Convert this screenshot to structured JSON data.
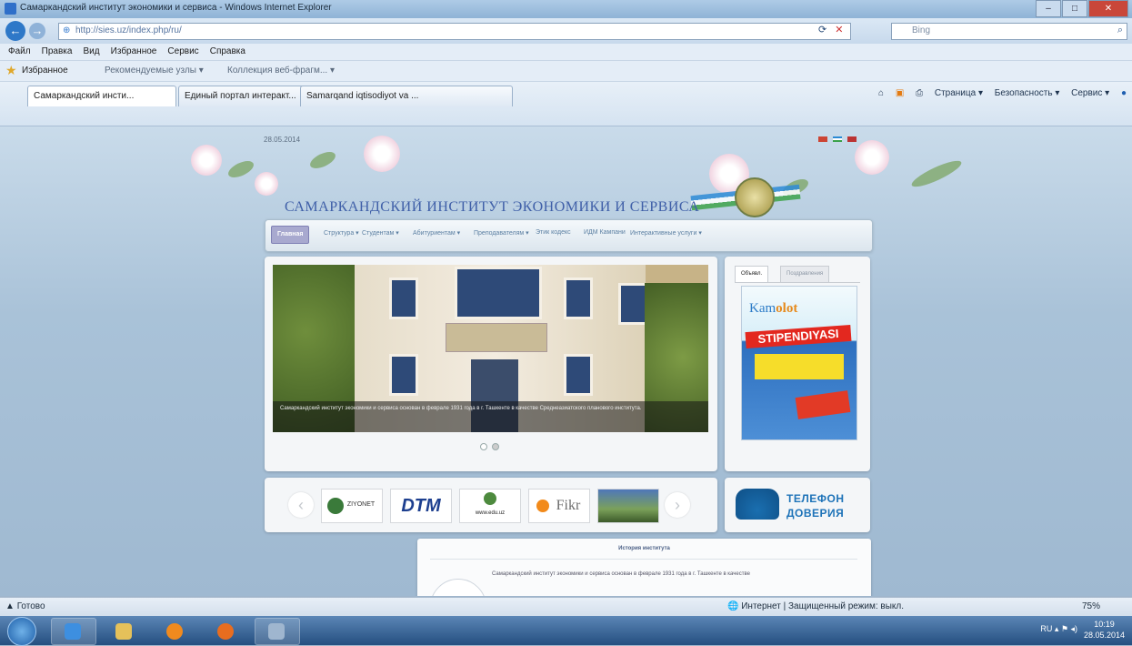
{
  "window": {
    "title": "Самаркандский институт экономики и сервиса - Windows Internet Explorer",
    "buttons": [
      "–",
      "□",
      "✕"
    ]
  },
  "address_bar": {
    "url": "http://sies.uz/index.php/ru/",
    "search_placeholder": "Bing"
  },
  "menu": [
    "Файл",
    "Правка",
    "Вид",
    "Избранное",
    "Сервис",
    "Справка"
  ],
  "favorites_bar": {
    "label": "Избранное",
    "items": [
      "Рекомендуемые узлы ▾",
      "Коллекция веб-фрагм... ▾"
    ]
  },
  "tabs": [
    {
      "label": "Самаркандский инсти...",
      "active": true
    },
    {
      "label": "Единый портал интеракт...",
      "active": false
    },
    {
      "label": "Samarqand iqtisodiyot va ...",
      "active": false
    }
  ],
  "command_bar": [
    "Страница ▾",
    "Безопасность ▾",
    "Сервис ▾"
  ],
  "page": {
    "date": "28.05.2014",
    "site_title": "САМАРКАНДСКИЙ ИНСТИТУТ ЭКОНОМИКИ И СЕРВИСА",
    "nav": [
      {
        "label": "Главная",
        "active": true
      },
      {
        "label": "Структура ▾"
      },
      {
        "label": "Студентам ▾"
      },
      {
        "label": "Абитуриентам ▾"
      },
      {
        "label": "Преподавателям ▾"
      },
      {
        "label": "Этик кодекс"
      },
      {
        "label": "ИДМ Кампани"
      },
      {
        "label": "Интерактивные услуги ▾"
      }
    ],
    "slide_caption": "Самаркандский институт экономики и сервиса основан в феврале 1931 года в г. Ташкенте в качестве Среднеазиатского планового института.",
    "right_tabs": [
      "Объявл.",
      "Поздравления"
    ],
    "poster": {
      "brand_a": "Kam",
      "brand_b": "olot",
      "stipend": "STIPENDIYASI"
    },
    "logos": [
      "ZIYONET",
      "DTM",
      "www.edu.uz",
      "Fikr",
      ""
    ],
    "phone": {
      "line1": "ТЕЛЕФОН",
      "line2": "ДОВЕРИЯ"
    },
    "history_heading": "История института",
    "history_text": "Самаркандский институт экономики и сервиса основан в феврале 1931 года в г. Ташкенте в качестве"
  },
  "status_bar": {
    "left": "Готово",
    "zone": "Интернет | Защищенный режим: выкл.",
    "zoom": "75%"
  },
  "taskbar": {
    "lang": "RU",
    "time": "10:19",
    "date": "28.05.2014"
  },
  "colors": {
    "accent": "#3f5fa8",
    "nav_active": "#a8a9cf",
    "poster_red": "#e3281f"
  }
}
